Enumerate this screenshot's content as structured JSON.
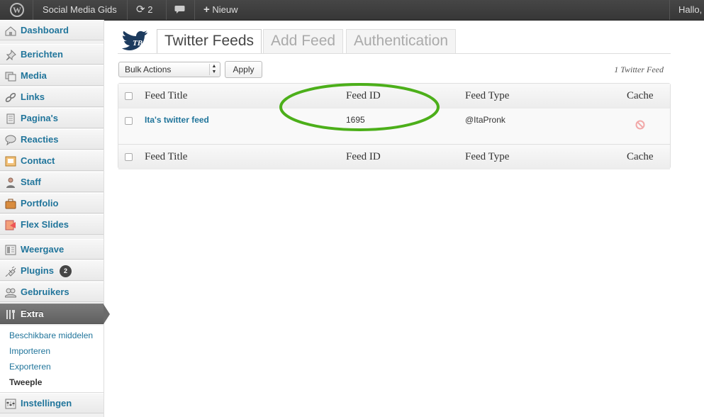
{
  "adminbar": {
    "site_name": "Social Media Gids",
    "updates_count": "2",
    "new_label": "Nieuw",
    "greeting": "Hallo,"
  },
  "sidebar": {
    "items": [
      {
        "label": "Dashboard",
        "icon": "dashboard-icon"
      },
      {
        "label": "Berichten",
        "icon": "pushpin-icon"
      },
      {
        "label": "Media",
        "icon": "media-icon"
      },
      {
        "label": "Links",
        "icon": "link-icon"
      },
      {
        "label": "Pagina's",
        "icon": "page-icon"
      },
      {
        "label": "Reacties",
        "icon": "comment-icon"
      },
      {
        "label": "Contact",
        "icon": "contact-icon"
      },
      {
        "label": "Staff",
        "icon": "staff-icon"
      },
      {
        "label": "Portfolio",
        "icon": "portfolio-icon"
      },
      {
        "label": "Flex Slides",
        "icon": "slides-icon"
      },
      {
        "label": "Weergave",
        "icon": "appearance-icon"
      },
      {
        "label": "Plugins",
        "icon": "plugin-icon",
        "badge": "2"
      },
      {
        "label": "Gebruikers",
        "icon": "users-icon"
      },
      {
        "label": "Extra",
        "icon": "tools-icon",
        "active": true
      },
      {
        "label": "Instellingen",
        "icon": "settings-icon"
      }
    ],
    "submenu": [
      "Beschikbare middelen",
      "Importeren",
      "Exporteren",
      "Tweeple"
    ]
  },
  "tabs": [
    "Twitter Feeds",
    "Add Feed",
    "Authentication"
  ],
  "bulk": {
    "select_value": "Bulk Actions",
    "apply_label": "Apply"
  },
  "item_count": "1 Twitter Feed",
  "table": {
    "columns": [
      "Feed Title",
      "Feed ID",
      "Feed Type",
      "Cache"
    ],
    "rows": [
      {
        "title": "Ita's twitter feed",
        "id": "1695",
        "type": "@ItaPronk"
      }
    ]
  },
  "colors": {
    "link": "#21759b",
    "annotation": "#4caf1a",
    "adminbar": "#464646"
  }
}
